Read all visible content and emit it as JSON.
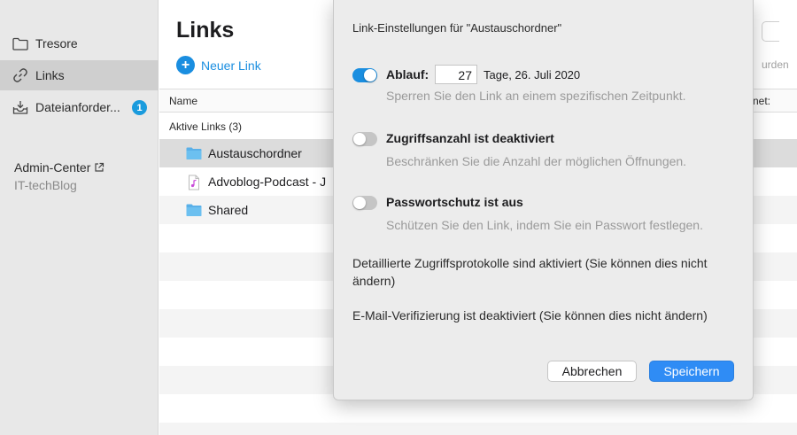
{
  "sidebar": {
    "items": [
      {
        "label": "Tresore",
        "icon": "folder-icon"
      },
      {
        "label": "Links",
        "icon": "link-icon"
      },
      {
        "label": "Dateianforder...",
        "icon": "inbox-icon",
        "badge": "1"
      }
    ],
    "admin_center": "Admin-Center",
    "organization": "IT-techBlog"
  },
  "main": {
    "title": "Links",
    "new_link": "Neuer Link",
    "partial_right_text": "urden",
    "table": {
      "col_name": "Name",
      "col_right_partial": "net:",
      "group_label": "Aktive Links (3)",
      "rows": [
        {
          "name": "Austauschordner",
          "icon": "folder-icon"
        },
        {
          "name": "Advoblog-Podcast - J",
          "icon": "audio-file-icon"
        },
        {
          "name": "Shared",
          "icon": "folder-icon"
        }
      ]
    }
  },
  "dialog": {
    "title": "Link-Einstellungen für \"Austauschordner\"",
    "expiry": {
      "label": "Ablauf:",
      "days": "27",
      "suffix": "Tage, 26. Juli 2020",
      "description": "Sperren Sie den Link an einem spezifischen Zeitpunkt.",
      "enabled": true
    },
    "access_count": {
      "label": "Zugriffsanzahl ist deaktiviert",
      "description": "Beschränken Sie die Anzahl der möglichen Öffnungen.",
      "enabled": false
    },
    "password": {
      "label": "Passwortschutz ist aus",
      "description": "Schützen Sie den Link, indem Sie ein Passwort festlegen.",
      "enabled": false
    },
    "info_access_log": "Detaillierte Zugriffsprotokolle sind aktiviert (Sie können dies nicht ändern)",
    "info_email": "E-Mail-Verifizierung ist deaktiviert (Sie können dies nicht ändern)",
    "cancel_label": "Abbrechen",
    "save_label": "Speichern"
  },
  "colors": {
    "accent": "#1a8ee0",
    "save_button": "#2f8cf5",
    "badge": "#1a9bdd"
  }
}
